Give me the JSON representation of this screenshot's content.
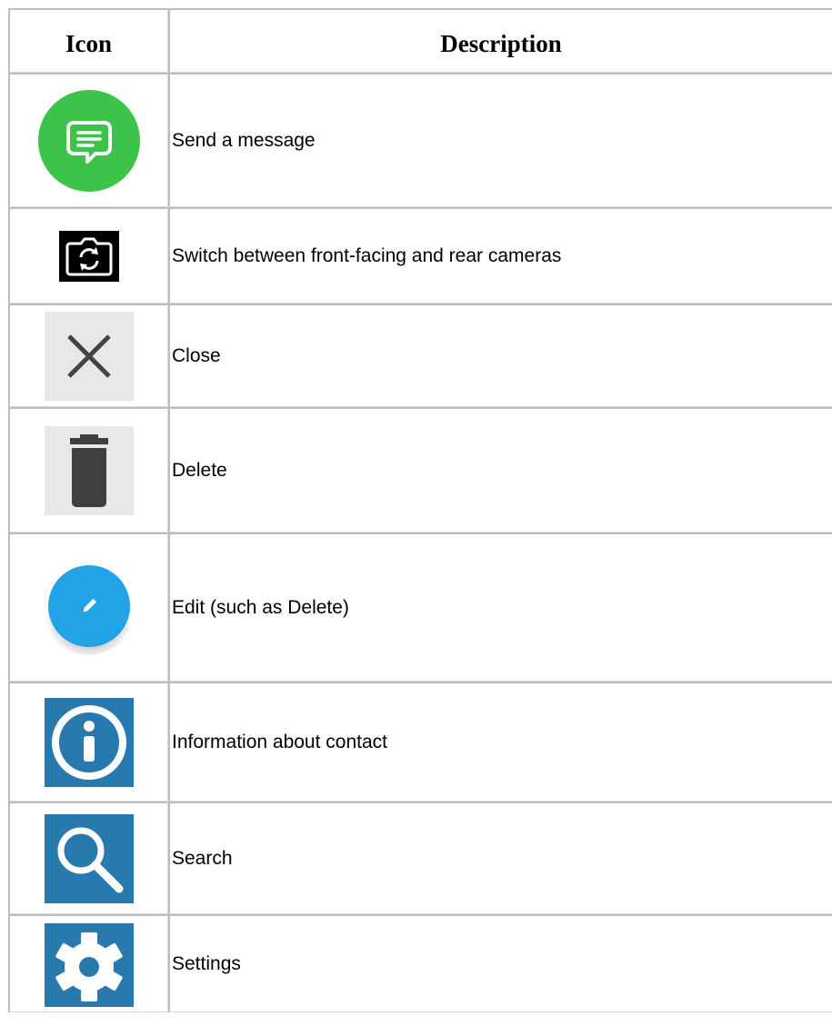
{
  "table": {
    "headers": {
      "icon": "Icon",
      "description": "Description"
    },
    "rows": [
      {
        "icon": "message-bubble-icon",
        "description": "Send a message"
      },
      {
        "icon": "switch-camera-icon",
        "description": "Switch between front-facing and rear cameras"
      },
      {
        "icon": "close-x-icon",
        "description": "Close"
      },
      {
        "icon": "trash-can-icon",
        "description": "Delete"
      },
      {
        "icon": "edit-pencil-icon",
        "description": "Edit (such as Delete)"
      },
      {
        "icon": "info-icon",
        "description": "Information about contact"
      },
      {
        "icon": "search-magnifier-icon",
        "description": "Search"
      },
      {
        "icon": "gear-icon",
        "description": "Settings"
      }
    ]
  },
  "colors": {
    "message_green": "#3cc34a",
    "camera_black": "#000000",
    "close_bg": "#e6e8ea",
    "close_x": "#444444",
    "trash_bg": "#e6e8ea",
    "trash_fill": "#3f3f3f",
    "edit_blue": "#22a3e6",
    "tile_blue": "#2779ae",
    "border": "#bdbdbd"
  }
}
